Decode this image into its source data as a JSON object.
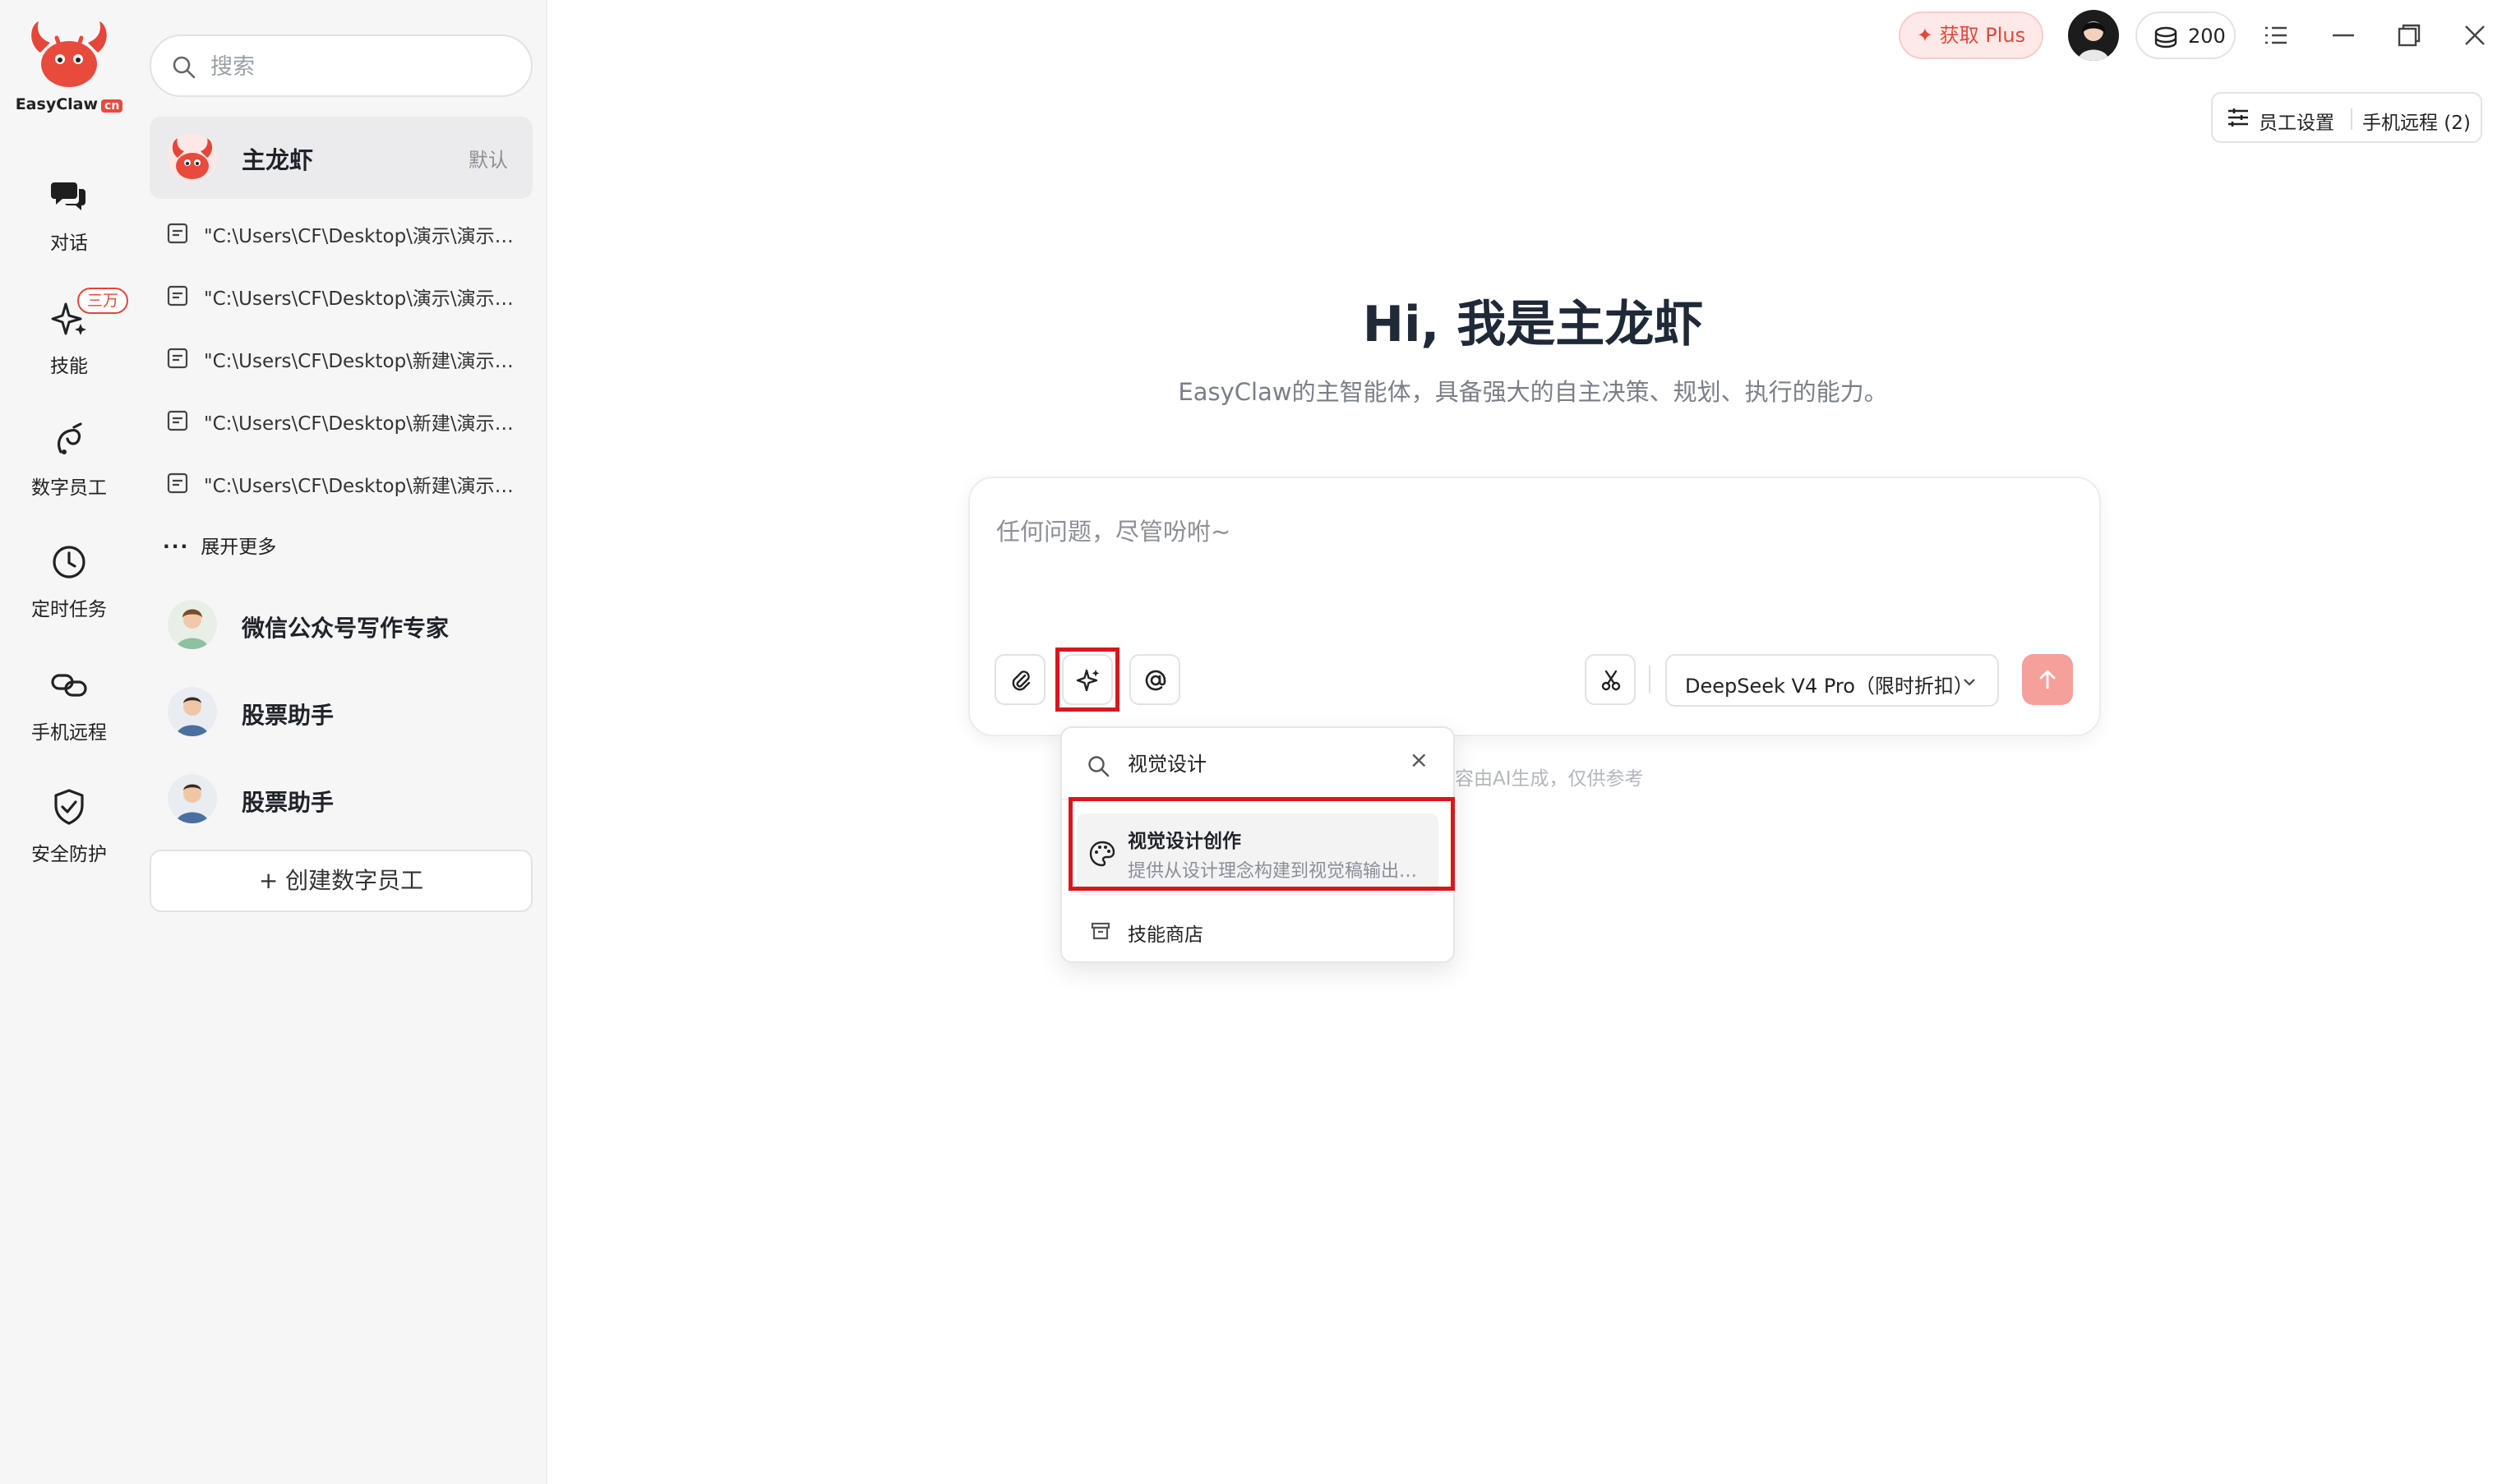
{
  "app": {
    "logo_text": "EasyClaw",
    "logo_badge": "cn"
  },
  "rail": {
    "items": [
      {
        "label": "对话",
        "icon": "chat-bubbles-icon"
      },
      {
        "label": "技能",
        "icon": "sparkle-icon",
        "badge": "三万"
      },
      {
        "label": "数字员工",
        "icon": "digital-employee-icon"
      },
      {
        "label": "定时任务",
        "icon": "clock-icon"
      },
      {
        "label": "手机远程",
        "icon": "link-icon"
      },
      {
        "label": "安全防护",
        "icon": "shield-check-icon"
      }
    ]
  },
  "sidebar": {
    "search_placeholder": "搜索",
    "main_agent": {
      "name": "主龙虾",
      "tag": "默认"
    },
    "files": [
      "\"C:\\Users\\CF\\Desktop\\演示\\演示.txt\"",
      "\"C:\\Users\\CF\\Desktop\\演示\\演示.txt\"",
      "\"C:\\Users\\CF\\Desktop\\新建\\演示.txt\"",
      "\"C:\\Users\\CF\\Desktop\\新建\\演示.txt\"",
      "\"C:\\Users\\CF\\Desktop\\新建\\演示.txt\""
    ],
    "more_label": "展开更多",
    "employees": [
      {
        "name": "微信公众号写作专家"
      },
      {
        "name": "股票助手"
      },
      {
        "name": "股票助手"
      }
    ],
    "create_label": "+ 创建数字员工"
  },
  "topbar": {
    "plus_label": "获取 Plus",
    "coins": "200",
    "employee_settings": "员工设置",
    "phone_remote": "手机远程 (2)"
  },
  "hero": {
    "title": "Hi, 我是主龙虾",
    "subtitle": "EasyClaw的主智能体，具备强大的自主决策、规划、执行的能力。"
  },
  "composer": {
    "placeholder": "任何问题，尽管吩咐~",
    "model": "DeepSeek V4 Pro（限时折扣）",
    "disclaimer": "容由AI生成，仅供参考"
  },
  "skill_popup": {
    "search_value": "视觉设计",
    "clear_icon": "×",
    "result": {
      "title": "视觉设计创作",
      "desc": "提供从设计理念构建到视觉稿输出的全流程设计能力"
    },
    "store_label": "技能商店"
  },
  "colors": {
    "accent": "#e5463a",
    "highlight": "#d9161c",
    "send": "#f5a09a"
  }
}
